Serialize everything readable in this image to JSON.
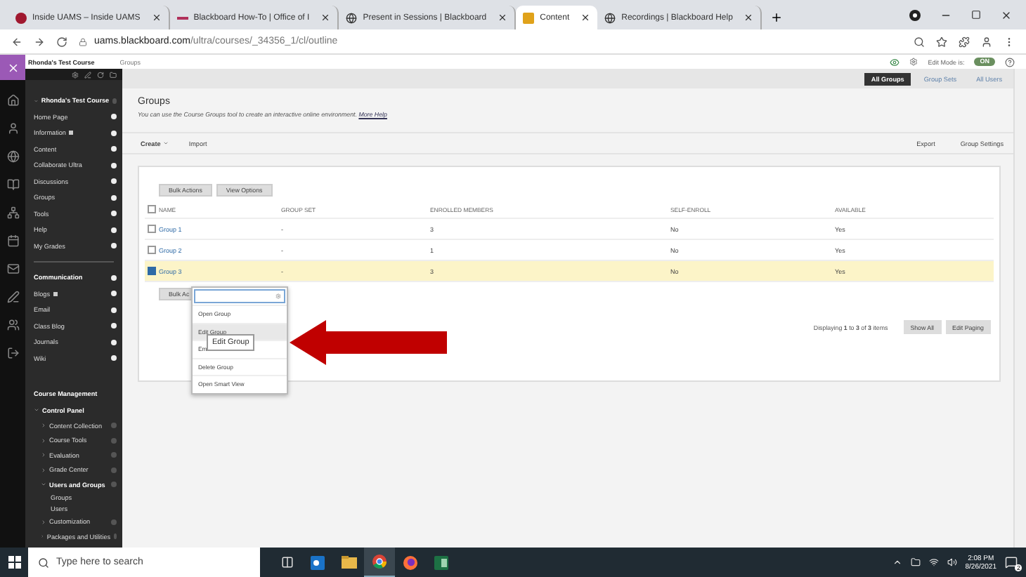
{
  "browser": {
    "tabs": [
      {
        "title": "Inside UAMS – Inside UAMS",
        "kind": "circle",
        "selected": false
      },
      {
        "title": "Blackboard How-To | Office of I",
        "kind": "line",
        "selected": false
      },
      {
        "title": "Present in Sessions | Blackboard",
        "kind": "globe",
        "selected": false
      },
      {
        "title": "Content",
        "kind": "square",
        "selected": true
      },
      {
        "title": "Recordings | Blackboard Help",
        "kind": "globe",
        "selected": false
      }
    ],
    "url_host": "uams.blackboard.com",
    "url_path": "/ultra/courses/_34356_1/cl/outline"
  },
  "header": {
    "breadcrumbs": [
      "Rhonda's Test Course",
      "Groups"
    ],
    "edit_mode_label": "Edit Mode is:",
    "edit_mode": "ON"
  },
  "course_menu": {
    "title": "Rhonda's Test Course",
    "items": [
      {
        "label": "Home Page",
        "kind": "link",
        "badge": false
      },
      {
        "label": "Information",
        "kind": "link",
        "badge": true
      },
      {
        "label": "Content",
        "kind": "link",
        "badge": false
      },
      {
        "label": "Collaborate Ultra",
        "kind": "link",
        "badge": false
      },
      {
        "label": "Discussions",
        "kind": "link",
        "badge": false
      },
      {
        "label": "Groups",
        "kind": "link",
        "badge": false
      },
      {
        "label": "Tools",
        "kind": "link",
        "badge": false
      },
      {
        "label": "Help",
        "kind": "link",
        "badge": false
      },
      {
        "label": "My Grades",
        "kind": "link",
        "badge": false
      },
      {
        "kind": "divider"
      },
      {
        "label": "Communication",
        "kind": "heading"
      },
      {
        "label": "Blogs",
        "kind": "link",
        "badge": true
      },
      {
        "label": "Email",
        "kind": "link",
        "badge": false
      },
      {
        "label": "Class Blog",
        "kind": "link",
        "badge": false
      },
      {
        "label": "Journals",
        "kind": "link",
        "badge": false
      },
      {
        "label": "Wiki",
        "kind": "link",
        "badge": false
      }
    ]
  },
  "management": {
    "title": "Course Management",
    "panel": "Control Panel",
    "items": [
      {
        "label": "Content Collection",
        "expanded": false
      },
      {
        "label": "Course Tools",
        "expanded": false
      },
      {
        "label": "Evaluation",
        "expanded": false
      },
      {
        "label": "Grade Center",
        "expanded": false
      },
      {
        "label": "Users and Groups",
        "expanded": true,
        "children": [
          {
            "label": "Groups"
          },
          {
            "label": "Users"
          }
        ]
      },
      {
        "label": "Customization",
        "expanded": false
      },
      {
        "label": "Packages and Utilities",
        "expanded": false
      }
    ]
  },
  "view_tabs": [
    {
      "label": "All Groups",
      "selected": true
    },
    {
      "label": "Group Sets",
      "selected": false
    },
    {
      "label": "All Users",
      "selected": false
    }
  ],
  "page": {
    "title": "Groups",
    "description": "You can use the Course Groups tool to create an interactive online environment.",
    "help_link": "More Help"
  },
  "actions": {
    "left": [
      {
        "label": "Create",
        "menu": true
      },
      {
        "label": "Import",
        "menu": false
      }
    ],
    "right": [
      "Export",
      "Group Settings"
    ]
  },
  "table": {
    "select_all_checked": false,
    "top_buttons": [
      "Bulk Actions",
      "View Options"
    ],
    "columns": [
      "NAME",
      "GROUP SET",
      "ENROLLED MEMBERS",
      "SELF-ENROLL",
      "AVAILABLE"
    ],
    "rows": [
      {
        "cells": [
          "Group 1",
          "-",
          "3",
          "No",
          "Yes"
        ],
        "selected": false
      },
      {
        "cells": [
          "Group 2",
          "-",
          "1",
          "No",
          "Yes"
        ],
        "selected": false
      },
      {
        "cells": [
          "Group 3",
          "-",
          "3",
          "No",
          "Yes"
        ],
        "selected": true
      }
    ],
    "bottom_button": "Bulk Ac"
  },
  "paging": {
    "summary": "Displaying **1** to **3** of **3** items",
    "buttons": [
      "Show All",
      "Edit Paging"
    ]
  },
  "context_menu": {
    "items": [
      {
        "label": "Open Group",
        "selected": false
      },
      {
        "label": "Edit Group",
        "selected": true
      },
      {
        "label": "Em",
        "selected": false
      },
      {
        "label": "Delete Group",
        "selected": false
      },
      {
        "label": "Open Smart View",
        "selected": false
      }
    ]
  },
  "tooltip": "Edit Group",
  "taskbar": {
    "search_placeholder": "Type here to search",
    "apps": [
      {
        "kind": "taskview",
        "selected": false
      },
      {
        "kind": "outlook",
        "selected": false
      },
      {
        "kind": "folder",
        "selected": false
      },
      {
        "kind": "chrome",
        "selected": true
      },
      {
        "kind": "firefox",
        "selected": false
      },
      {
        "kind": "excel",
        "selected": false
      }
    ],
    "time": "2:08 PM",
    "date": "8/26/2021",
    "notifications": "2"
  }
}
